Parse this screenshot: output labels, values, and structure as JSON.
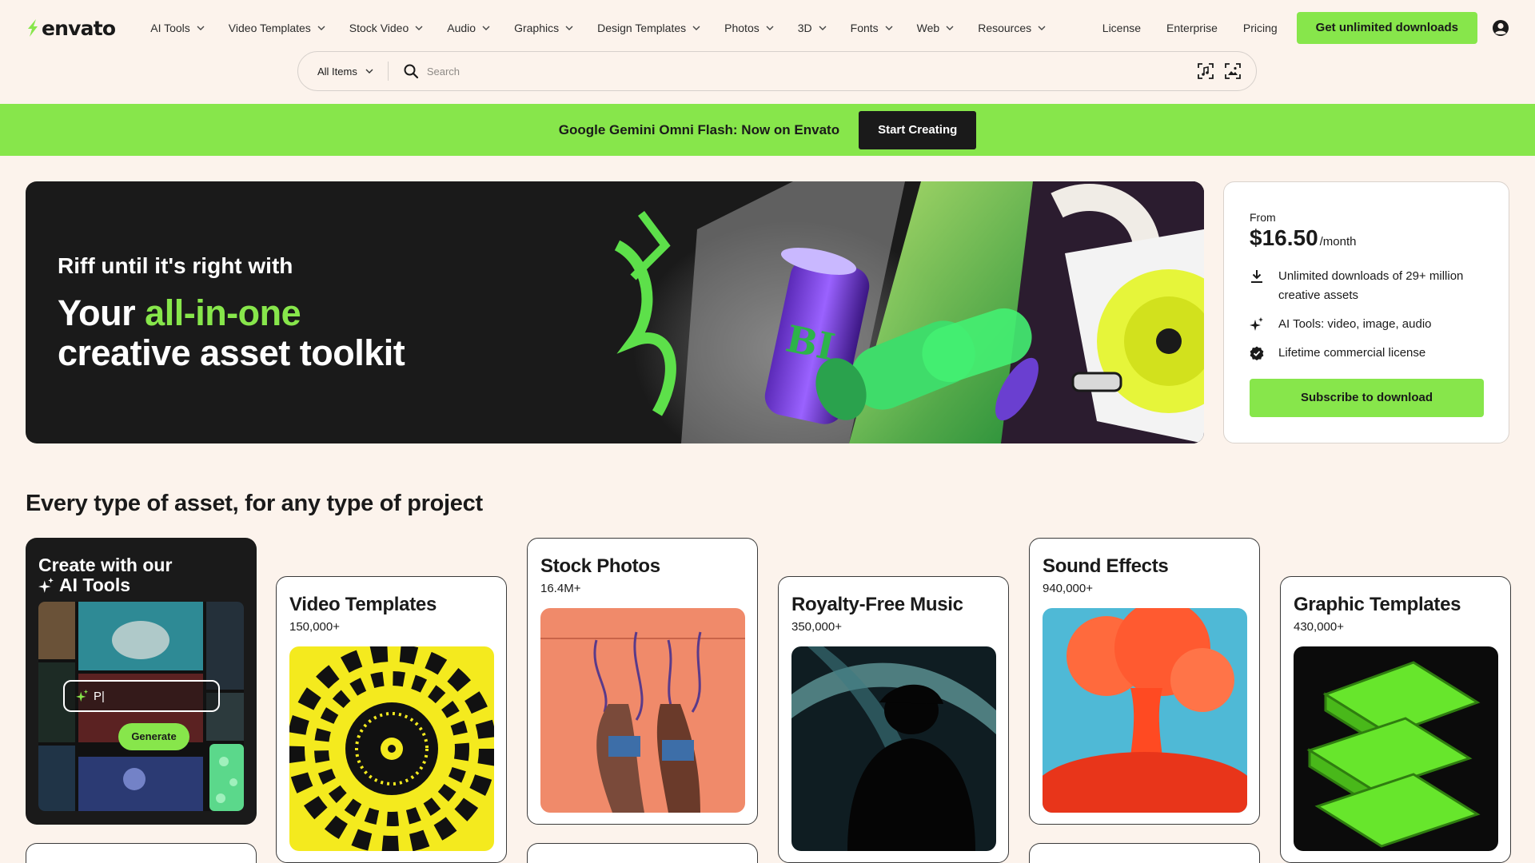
{
  "brand": {
    "name": "envato",
    "accent": "#87e64b",
    "dark": "#1a1a1a",
    "background": "#fcf3ec"
  },
  "nav": {
    "items": [
      {
        "label": "AI Tools"
      },
      {
        "label": "Video Templates"
      },
      {
        "label": "Stock Video"
      },
      {
        "label": "Audio"
      },
      {
        "label": "Graphics"
      },
      {
        "label": "Design Templates"
      },
      {
        "label": "Photos"
      },
      {
        "label": "3D"
      },
      {
        "label": "Fonts"
      },
      {
        "label": "Web"
      },
      {
        "label": "Resources"
      }
    ],
    "links": {
      "license": "License",
      "enterprise": "Enterprise",
      "pricing": "Pricing"
    },
    "cta": "Get unlimited downloads",
    "account_icon": "user-circle-icon"
  },
  "search": {
    "category": "All Items",
    "placeholder": "Search",
    "value": "",
    "tools": [
      "music-search-icon",
      "image-search-icon"
    ]
  },
  "promo": {
    "text": "Google Gemini Omni Flash: Now on Envato",
    "button": "Start Creating"
  },
  "hero": {
    "subtitle": "Riff until it's right with",
    "title_prefix": "Your ",
    "title_accent": "all-in-one",
    "title_suffix": "creative asset toolkit"
  },
  "pricing": {
    "from": "From",
    "price": "$16.50",
    "period": "/month",
    "features": [
      {
        "icon": "download-icon",
        "text": "Unlimited downloads of 29+ million creative assets"
      },
      {
        "icon": "sparkle-icon",
        "text": "AI Tools: video, image, audio"
      },
      {
        "icon": "verified-badge-icon",
        "text": "Lifetime commercial license"
      }
    ],
    "button": "Subscribe to download"
  },
  "section": {
    "title": "Every type of asset, for any type of project"
  },
  "ai_card": {
    "line1": "Create with our",
    "line2": "AI Tools",
    "prompt_text": "P|",
    "button": "Generate"
  },
  "categories": [
    {
      "title": "Video Templates",
      "count": "150,000+"
    },
    {
      "title": "Stock Photos",
      "count": "16.4M+"
    },
    {
      "title": "Royalty-Free Music",
      "count": "350,000+"
    },
    {
      "title": "Sound Effects",
      "count": "940,000+"
    },
    {
      "title": "Graphic Templates",
      "count": "430,000+"
    }
  ]
}
